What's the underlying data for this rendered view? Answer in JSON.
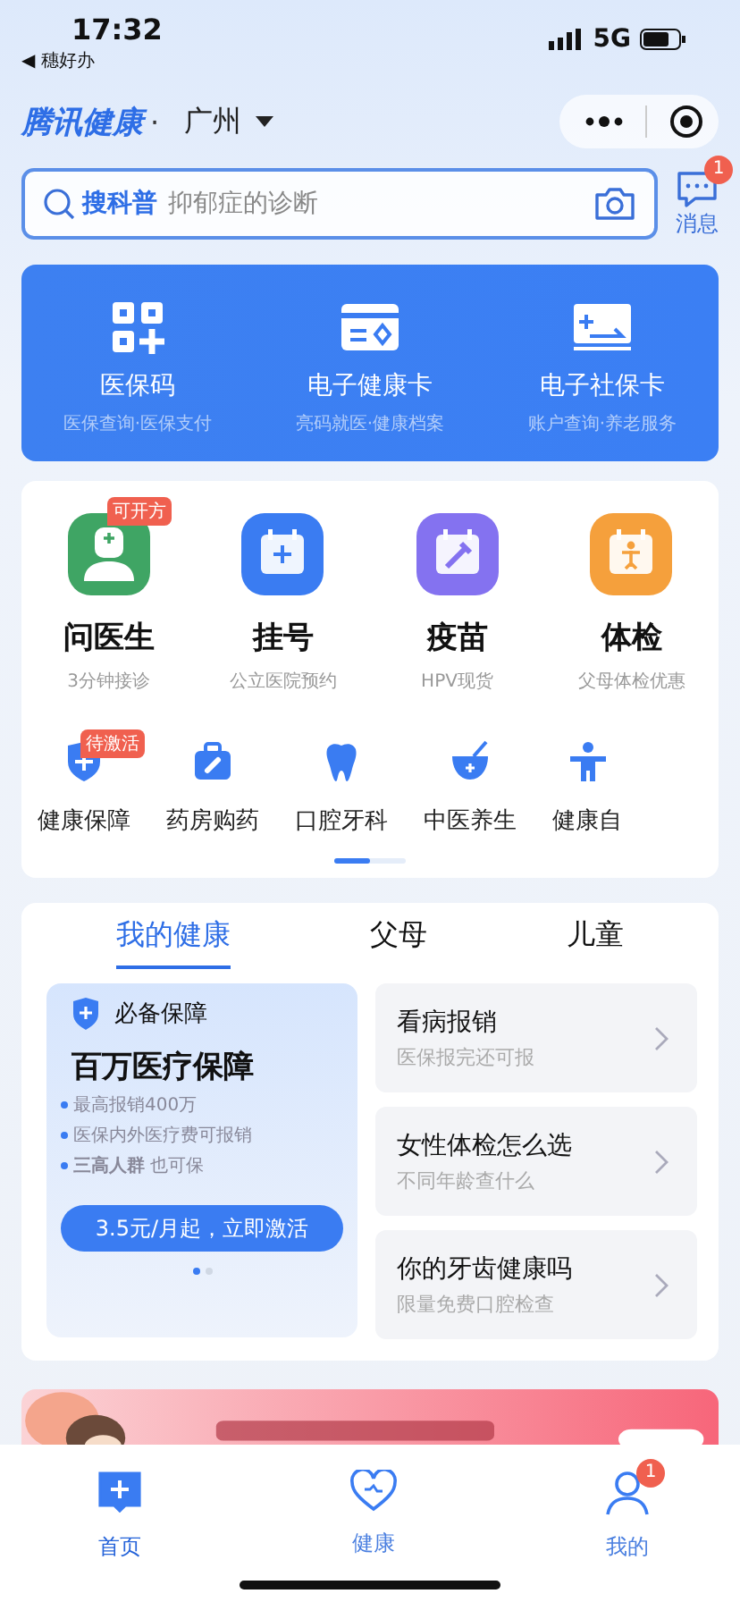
{
  "status_bar": {
    "time": "17:32",
    "back_app": "◀ 穗好办",
    "network": "5G"
  },
  "header": {
    "brand": "腾讯健康",
    "separator": "·",
    "city": "广州"
  },
  "search": {
    "keyword": "搜科普",
    "placeholder": "抑郁症的诊断"
  },
  "messages": {
    "label": "消息",
    "badge": "1"
  },
  "cards": [
    {
      "title": "医保码",
      "subtitle": "医保查询·医保支付",
      "kind": "qr"
    },
    {
      "title": "电子健康卡",
      "subtitle": "亮码就医·健康档案",
      "kind": "card"
    },
    {
      "title": "电子社保卡",
      "subtitle": "账户查询·养老服务",
      "kind": "social"
    }
  ],
  "main_services": [
    {
      "title": "问医生",
      "subtitle": "3分钟接诊",
      "badge": "可开方",
      "color": "#3fa564",
      "kind": "doctor"
    },
    {
      "title": "挂号",
      "subtitle": "公立医院预约",
      "color": "#3a7cf2",
      "kind": "calendar"
    },
    {
      "title": "疫苗",
      "subtitle": "HPV现货",
      "color": "#8472f0",
      "kind": "vaccine"
    },
    {
      "title": "体检",
      "subtitle": "父母体检优惠",
      "color": "#f5a03c",
      "kind": "checkup"
    }
  ],
  "shortcuts": [
    {
      "label": "健康保障",
      "badge": "待激活",
      "kind": "shield"
    },
    {
      "label": "药房购药",
      "kind": "kit"
    },
    {
      "label": "口腔牙科",
      "kind": "tooth"
    },
    {
      "label": "中医养生",
      "kind": "bowl"
    },
    {
      "label": "健康自",
      "kind": "person"
    }
  ],
  "health_tabs": [
    {
      "label": "我的健康",
      "selected": true
    },
    {
      "label": "父母",
      "selected": false
    },
    {
      "label": "儿童",
      "selected": false
    }
  ],
  "promo": {
    "tag": "必备保障",
    "title": "百万医疗保障",
    "points": [
      {
        "text": "最高报销400万"
      },
      {
        "text": "医保内外医疗费可报销"
      },
      {
        "text": "**三高人群**也可保"
      }
    ],
    "button": "3.5元/月起，立即激活"
  },
  "articles": [
    {
      "title": "看病报销",
      "subtitle": "医保报完还可报"
    },
    {
      "title": "女性体检怎么选",
      "subtitle": "不同年龄查什么"
    },
    {
      "title": "你的牙齿健康吗",
      "subtitle": "限量免费口腔检查"
    }
  ],
  "tab_bar": [
    {
      "label": "首页",
      "selected": true,
      "kind": "home"
    },
    {
      "label": "健康",
      "selected": false,
      "kind": "heart"
    },
    {
      "label": "我的",
      "selected": false,
      "kind": "user",
      "badge": "1"
    }
  ]
}
